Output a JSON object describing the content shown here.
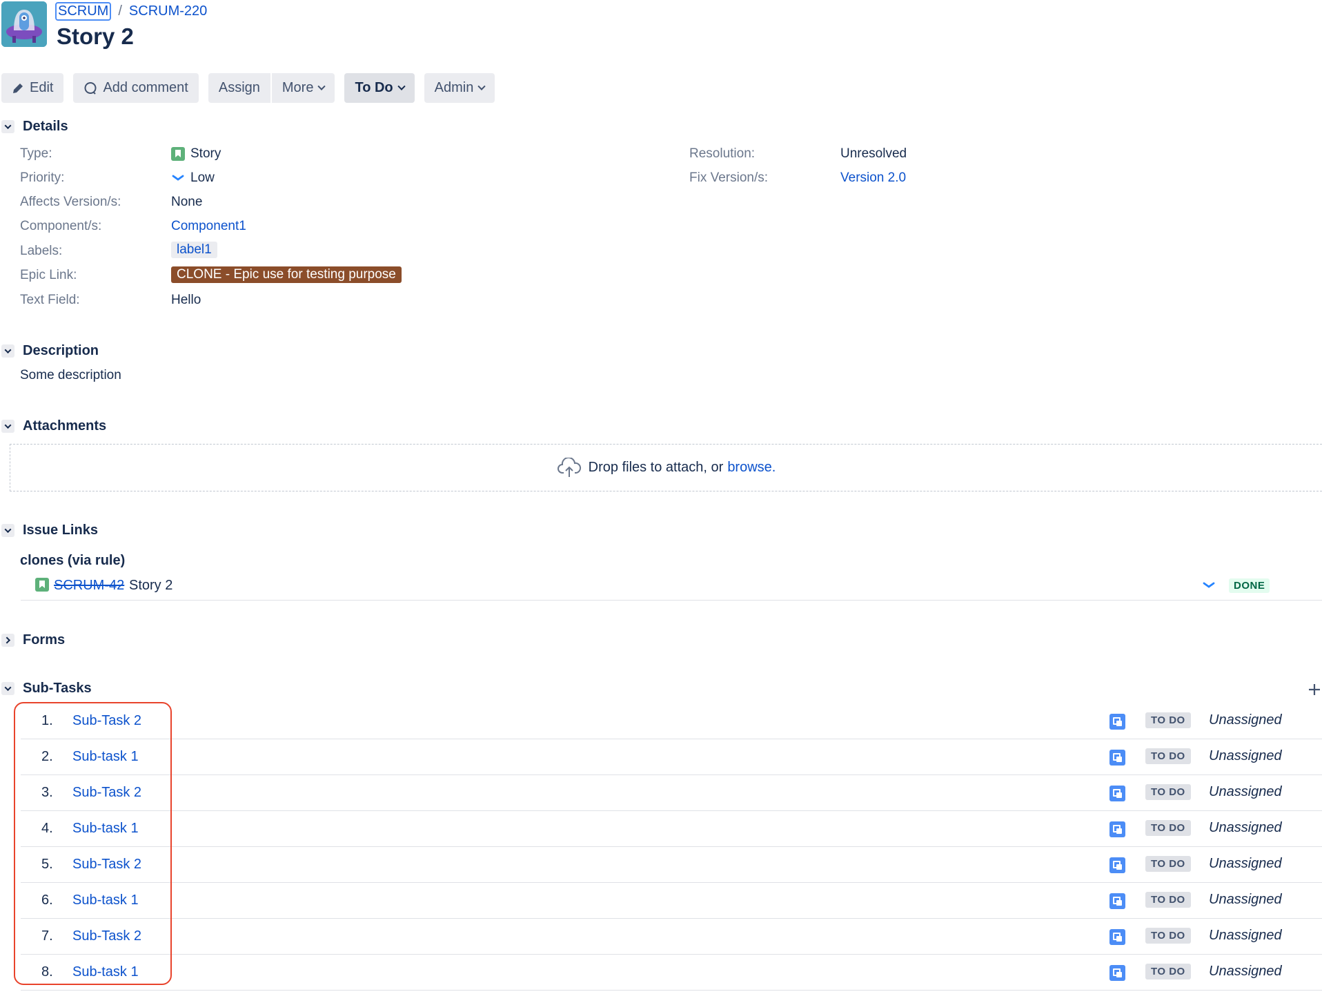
{
  "header": {
    "project_key": "SCRUM",
    "separator": "/",
    "issue_key": "SCRUM-220",
    "title": "Story 2"
  },
  "toolbar": {
    "edit": "Edit",
    "add_comment": "Add comment",
    "assign": "Assign",
    "more": "More",
    "status": "To Do",
    "admin": "Admin"
  },
  "details": {
    "heading": "Details",
    "left": [
      {
        "label": "Type:",
        "value": "Story",
        "icon": "story-icon"
      },
      {
        "label": "Priority:",
        "value": "Low",
        "icon": "priority-low-icon"
      },
      {
        "label": "Affects Version/s:",
        "value": "None"
      },
      {
        "label": "Component/s:",
        "value": "Component1"
      },
      {
        "label": "Labels:",
        "value": "label1"
      },
      {
        "label": "Epic Link:",
        "value": "CLONE - Epic use for testing purpose"
      },
      {
        "label": "Text Field:",
        "value": "Hello"
      }
    ],
    "right": [
      {
        "label": "Resolution:",
        "value": "Unresolved"
      },
      {
        "label": "Fix Version/s:",
        "value": "Version 2.0"
      }
    ],
    "colors": {
      "epic": "#8b4d2a",
      "story": "#5eb17a",
      "link": "#0c52cc"
    }
  },
  "description": {
    "heading": "Description",
    "text": "Some description"
  },
  "attachments": {
    "heading": "Attachments",
    "drop_text": "Drop files to attach, or",
    "browse_link": "browse."
  },
  "issue_links": {
    "heading": "Issue Links",
    "group_label": "clones (via rule)",
    "items": [
      {
        "key": "SCRUM-42",
        "summary": "Story 2",
        "status": "DONE",
        "priority": "Low",
        "resolved": true
      }
    ]
  },
  "forms": {
    "heading": "Forms"
  },
  "subtasks": {
    "heading": "Sub-Tasks",
    "add_icon": "plus-icon",
    "items": [
      {
        "num": "1.",
        "name": "Sub-Task 2",
        "status": "TO DO",
        "assignee": "Unassigned"
      },
      {
        "num": "2.",
        "name": "Sub-task 1",
        "status": "TO DO",
        "assignee": "Unassigned"
      },
      {
        "num": "3.",
        "name": "Sub-Task 2",
        "status": "TO DO",
        "assignee": "Unassigned"
      },
      {
        "num": "4.",
        "name": "Sub-task 1",
        "status": "TO DO",
        "assignee": "Unassigned"
      },
      {
        "num": "5.",
        "name": "Sub-Task 2",
        "status": "TO DO",
        "assignee": "Unassigned"
      },
      {
        "num": "6.",
        "name": "Sub-task 1",
        "status": "TO DO",
        "assignee": "Unassigned"
      },
      {
        "num": "7.",
        "name": "Sub-Task 2",
        "status": "TO DO",
        "assignee": "Unassigned"
      },
      {
        "num": "8.",
        "name": "Sub-task 1",
        "status": "TO DO",
        "assignee": "Unassigned"
      }
    ],
    "highlight_color": "#e8432b"
  }
}
